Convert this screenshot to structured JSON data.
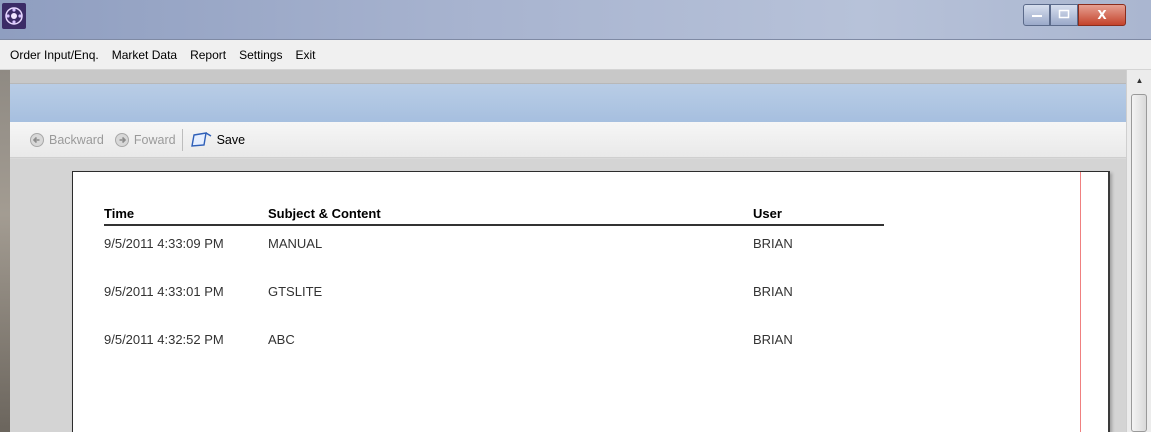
{
  "window": {
    "title": "",
    "icon": "app-flower-icon",
    "controls": [
      "minimize-icon",
      "maximize-icon",
      "close-icon"
    ],
    "close_label": "X"
  },
  "menu": {
    "items": [
      {
        "label": "Order Input/Enq."
      },
      {
        "label": "Market Data"
      },
      {
        "label": "Report"
      },
      {
        "label": "Settings"
      },
      {
        "label": "Exit"
      }
    ]
  },
  "toolbar": {
    "backward_label": "Backward",
    "forward_label": "Foward",
    "save_label": "Save",
    "backward_icon": "back-arrow-icon",
    "forward_icon": "forward-arrow-icon",
    "save_icon": "save-icon"
  },
  "report": {
    "columns": {
      "time": "Time",
      "subject": "Subject & Content",
      "user": "User"
    },
    "rows": [
      {
        "time": "9/5/2011 4:33:09 PM",
        "subject": "MANUAL",
        "user": "BRIAN"
      },
      {
        "time": "9/5/2011 4:33:01 PM",
        "subject": "GTSLITE",
        "user": "BRIAN"
      },
      {
        "time": "9/5/2011 4:32:52 PM",
        "subject": "ABC",
        "user": "BRIAN"
      }
    ]
  },
  "colors": {
    "title_bar": "#a7b3cf",
    "close_button": "#c4432b",
    "ribbon_band": "#b9cde6",
    "margin_line": "#f08080"
  }
}
